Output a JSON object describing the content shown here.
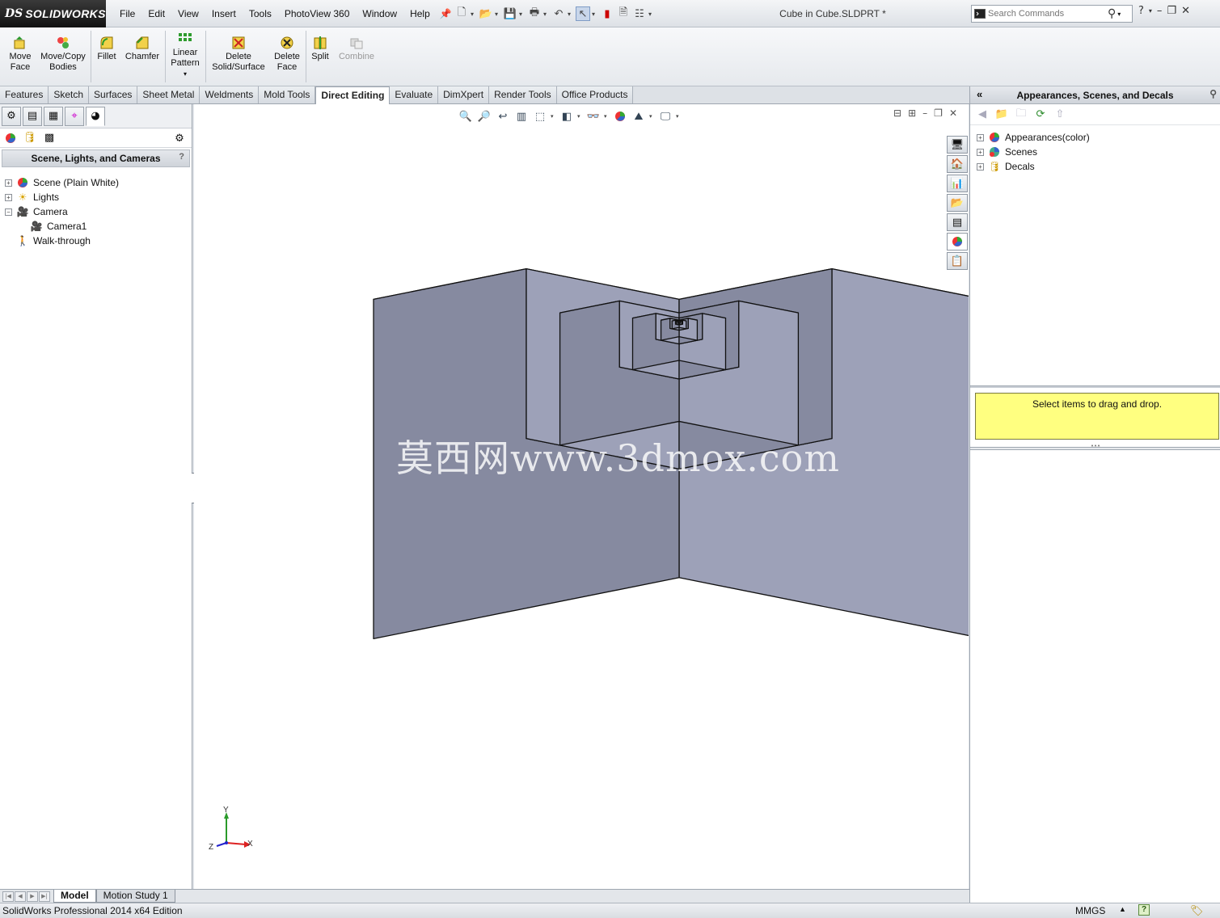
{
  "app": {
    "logo_ds": "DS",
    "logo_name": "SOLIDWORKS",
    "document_title": "Cube in Cube.SLDPRT *"
  },
  "menu": [
    "File",
    "Edit",
    "View",
    "Insert",
    "Tools",
    "PhotoView 360",
    "Window",
    "Help"
  ],
  "search": {
    "placeholder": "Search Commands"
  },
  "ribbon": {
    "move_face": "Move Face",
    "move_copy_bodies": "Move/Copy Bodies",
    "fillet": "Fillet",
    "chamfer": "Chamfer",
    "linear_pattern": "Linear Pattern",
    "delete_solid_surface": "Delete Solid/Surface",
    "delete_face": "Delete Face",
    "split": "Split",
    "combine": "Combine"
  },
  "tabs": [
    "Features",
    "Sketch",
    "Surfaces",
    "Sheet Metal",
    "Weldments",
    "Mold Tools",
    "Direct Editing",
    "Evaluate",
    "DimXpert",
    "Render Tools",
    "Office Products"
  ],
  "active_tab": "Direct Editing",
  "left_panel": {
    "title": "Scene, Lights, and Cameras",
    "help": "?",
    "tree": {
      "scene": "Scene (Plain White)",
      "lights": "Lights",
      "camera": "Camera",
      "camera1": "Camera1",
      "walkthrough": "Walk-through"
    }
  },
  "viewport": {
    "watermark": "莫西网www.3dmox.com",
    "triad": {
      "x": "X",
      "y": "Y",
      "z": "Z"
    },
    "colors": {
      "light_face": "#cfd3ea",
      "mid_face": "#9da1b8",
      "dark_face": "#868aa0",
      "edge": "#111111"
    }
  },
  "right_panel": {
    "title": "Appearances, Scenes, and Decals",
    "tree": {
      "appearances": "Appearances(color)",
      "scenes": "Scenes",
      "decals": "Decals"
    },
    "drop_hint": "Select items to drag and drop."
  },
  "model_tabs": {
    "model": "Model",
    "motion": "Motion Study 1"
  },
  "status": {
    "edition": "SolidWorks Professional 2014 x64 Edition",
    "units": "MMGS"
  }
}
